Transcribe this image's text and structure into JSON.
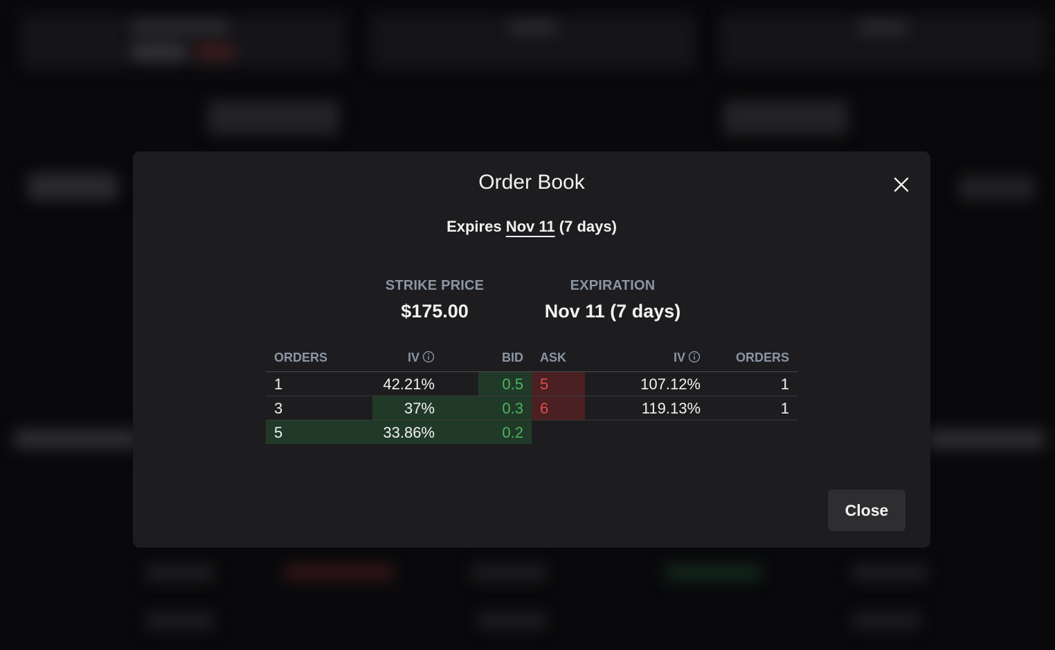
{
  "modal": {
    "title": "Order Book",
    "expires_prefix": "Expires",
    "expires_date": "Nov 11",
    "expires_days": "(7 days)",
    "close_label": "Close"
  },
  "summary": {
    "strike_label": "STRIKE PRICE",
    "strike_value": "$175.00",
    "expiration_label": "EXPIRATION",
    "expiration_value": "Nov 11 (7 days)"
  },
  "book": {
    "headers": {
      "bid_orders": "ORDERS",
      "bid_iv": "IV",
      "bid": "BID",
      "ask": "ASK",
      "ask_iv": "IV",
      "ask_orders": "ORDERS"
    },
    "bids": [
      {
        "orders": "1",
        "iv": "42.21%",
        "price": "0.5",
        "depth_fraction": 0.2
      },
      {
        "orders": "3",
        "iv": "37%",
        "price": "0.3",
        "depth_fraction": 0.6
      },
      {
        "orders": "5",
        "iv": "33.86%",
        "price": "0.2",
        "depth_fraction": 1.0
      }
    ],
    "asks": [
      {
        "price": "5",
        "iv": "107.12%",
        "orders": "1",
        "depth_fraction": 0.2
      },
      {
        "price": "6",
        "iv": "119.13%",
        "orders": "1",
        "depth_fraction": 0.2
      }
    ]
  },
  "colors": {
    "bid_text": "#4fb35f",
    "ask_text": "#e24d4a",
    "bid_bar": "#213a28",
    "ask_bar": "#4a2022",
    "modal_bg": "#1d1d1f",
    "header_text": "#8b95a5"
  },
  "icons": {
    "close": "close-icon",
    "info": "info-icon"
  }
}
